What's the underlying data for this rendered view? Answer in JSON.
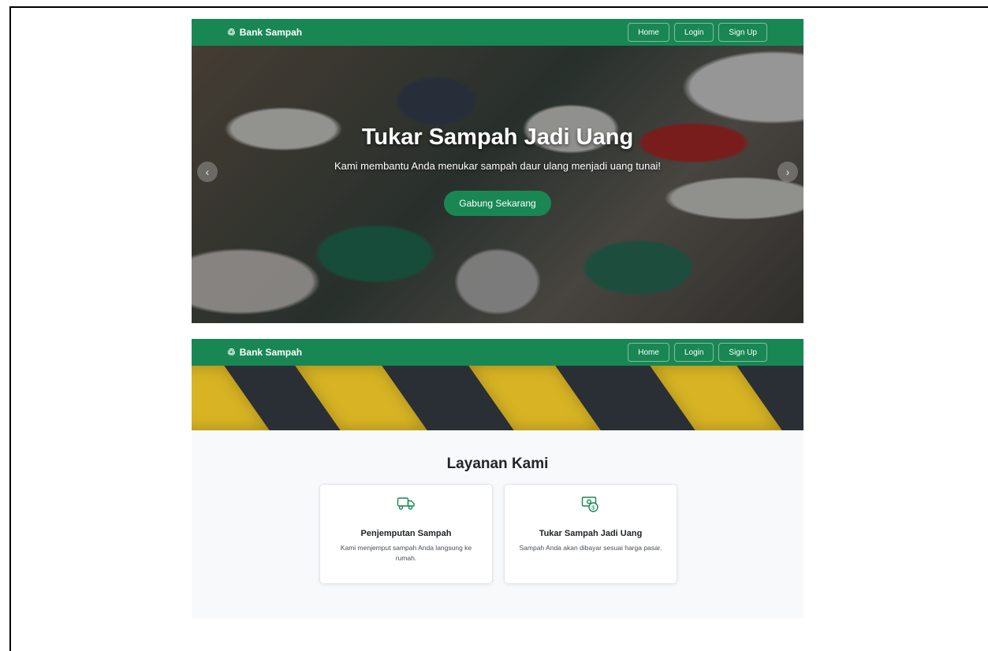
{
  "screens": [
    {
      "navbar": {
        "brand": "Bank Sampah",
        "brand_icon": "recycle-icon",
        "links": [
          "Home",
          "Login",
          "Sign Up"
        ]
      },
      "hero": {
        "title": "Tukar Sampah Jadi Uang",
        "subtitle": "Kami membantu Anda menukar sampah daur ulang menjadi uang tunai!",
        "cta": "Gabung Sekarang",
        "prev_icon": "chevron-left-icon",
        "next_icon": "chevron-right-icon"
      }
    },
    {
      "navbar": {
        "brand": "Bank Sampah",
        "brand_icon": "recycle-icon",
        "links": [
          "Home",
          "Login",
          "Sign Up"
        ]
      },
      "services": {
        "title": "Layanan Kami",
        "items": [
          {
            "icon": "truck-icon",
            "title": "Penjemputan Sampah",
            "text": "Kami menjemput sampah Anda langsung ke rumah."
          },
          {
            "icon": "cash-coin-icon",
            "title": "Tukar Sampah Jadi Uang",
            "text": "Sampah Anda akan dibayar sesuai harga pasar."
          }
        ]
      }
    }
  ],
  "colors": {
    "primary": "#198754",
    "section_bg": "#f8f9fa",
    "stripe_yellow": "#d8b424"
  }
}
